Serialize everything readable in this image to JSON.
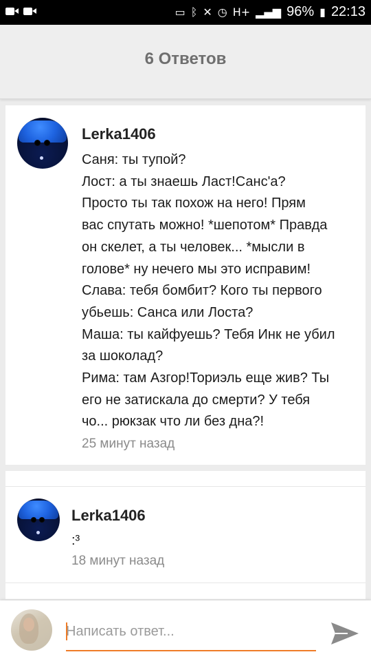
{
  "status_bar": {
    "signal_label": "H+",
    "battery": "96%",
    "time": "22:13"
  },
  "header": {
    "title": "6 Ответов"
  },
  "comments": [
    {
      "author": "Lerka1406",
      "lines": [
        "Саня: ты тупой?",
        "Лост: а ты знаешь Ласт!Санс'а?",
        "Просто ты так похож на него! Прям",
        "вас спутать можно! *шепотом* Правда",
        "он скелет, а ты человек... *мысли в",
        "голове* ну нечего мы это исправим!",
        "Слава: тебя бомбит? Кого ты первого",
        "убьешь: Санса или Лоста?",
        "Маша: ты кайфуешь? Тебя Инк не убил",
        "за шоколад?",
        "Рима: там Азгор!Ториэль еще жив? Ты",
        "его не затискала до смерти? У тебя",
        "чо... рюкзак что ли без дна?!"
      ],
      "time": "25 минут назад"
    },
    {
      "author": "Lerka1406",
      "text": ":³",
      "time": "18 минут назад"
    }
  ],
  "composer": {
    "placeholder": "Написать ответ..."
  },
  "colors": {
    "accent": "#ef7c27"
  },
  "icons": [
    "camera-icon",
    "cast-icon",
    "bluetooth-icon",
    "mute-icon",
    "alarm-icon",
    "signal-icon",
    "send-icon"
  ]
}
